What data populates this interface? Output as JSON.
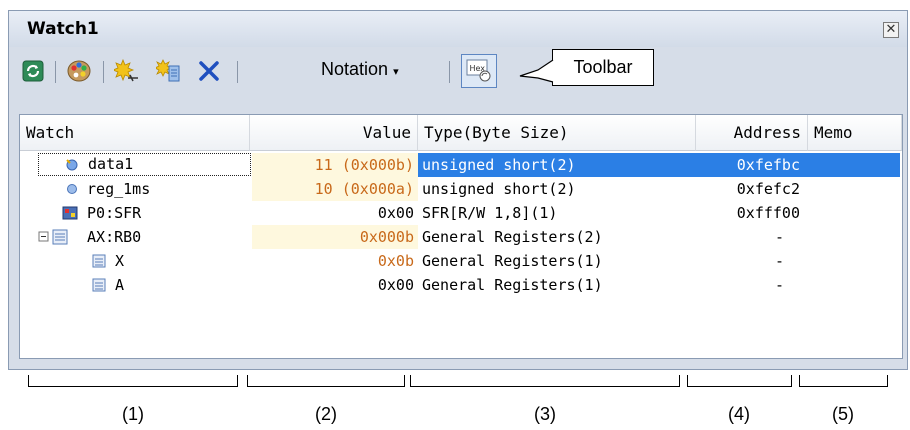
{
  "window": {
    "title": "Watch1",
    "close_label": "✕"
  },
  "toolbar": {
    "notation_label": "Notation",
    "hex_label": "Hex"
  },
  "callout": {
    "label": "Toolbar"
  },
  "columns": [
    "Watch",
    "Value",
    "Type(Byte Size)",
    "Address",
    "Memo"
  ],
  "rows": [
    {
      "name": "data1",
      "value": "11 (0x000b)",
      "type": "unsigned short(2)",
      "address": "0xfefbc",
      "memo": ""
    },
    {
      "name": "reg_1ms",
      "value": "10 (0x000a)",
      "type": "unsigned short(2)",
      "address": "0xfefc2",
      "memo": ""
    },
    {
      "name": "P0:SFR",
      "value": "0x00",
      "type": "SFR[R/W 1,8](1)",
      "address": "0xfff00",
      "memo": ""
    },
    {
      "name": "AX:RB0",
      "value": "0x000b",
      "type": "General Registers(2)",
      "address": "-",
      "memo": ""
    },
    {
      "name": "X",
      "value": "0x0b",
      "type": "General Registers(1)",
      "address": "-",
      "memo": ""
    },
    {
      "name": "A",
      "value": "0x00",
      "type": "General Registers(1)",
      "address": "-",
      "memo": ""
    }
  ],
  "section_labels": [
    "(1)",
    "(2)",
    "(3)",
    "(4)",
    "(5)"
  ]
}
